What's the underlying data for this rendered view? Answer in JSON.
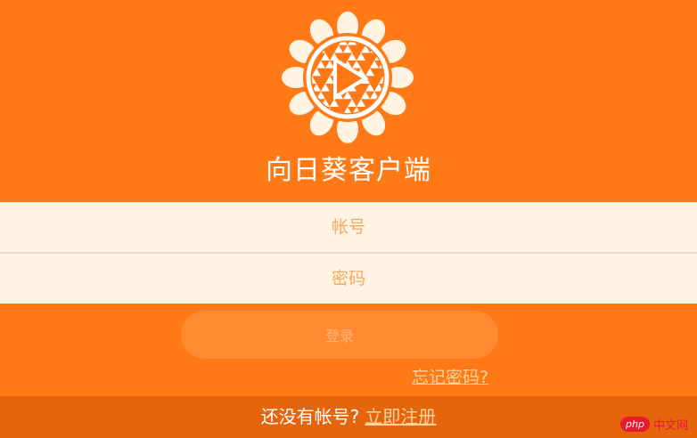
{
  "app": {
    "title": "向日葵客户端"
  },
  "form": {
    "username_placeholder": "帐号",
    "password_placeholder": "密码",
    "login_label": "登录",
    "forgot_label": "忘记密码?"
  },
  "footer": {
    "prompt": "还没有帐号?",
    "register_label": "立即注册"
  },
  "watermark": {
    "badge": "php",
    "text": "中文网"
  },
  "colors": {
    "background": "#ff7a17",
    "field_bg": "#fff3e1",
    "footer_bg": "#e6650c",
    "link": "#ffd49c"
  },
  "icons": {
    "logo": "sunflower-play-logo"
  }
}
